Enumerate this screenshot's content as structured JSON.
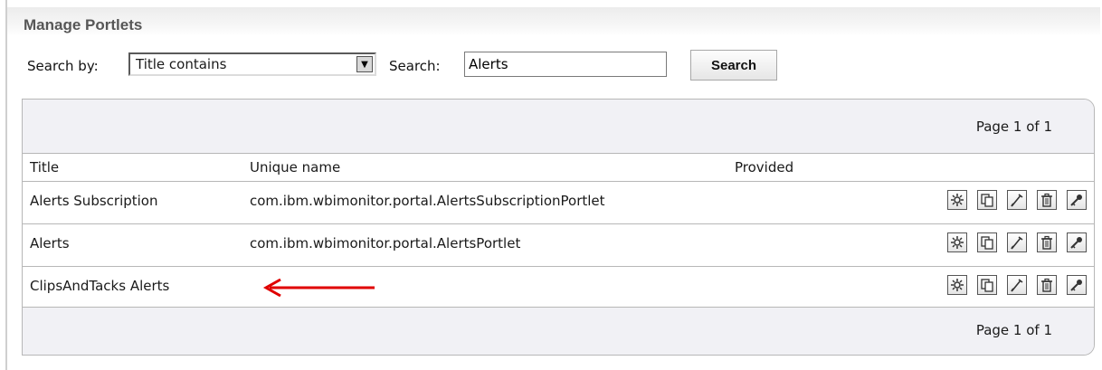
{
  "portlet": {
    "title": "Manage Portlets"
  },
  "search": {
    "search_by_label": "Search by:",
    "search_by_value": "Title contains",
    "search_label": "Search:",
    "search_value": "Alerts",
    "search_button": "Search"
  },
  "table": {
    "pager_top": "Page 1 of 1",
    "pager_bottom": "Page 1 of 1",
    "columns": [
      "Title",
      "Unique name",
      "Provided"
    ],
    "rows": [
      {
        "title": "Alerts Subscription",
        "unique_name": "com.ibm.wbimonitor.portal.AlertsSubscriptionPortlet",
        "provided": ""
      },
      {
        "title": "Alerts",
        "unique_name": "com.ibm.wbimonitor.portal.AlertsPortlet",
        "provided": ""
      },
      {
        "title": "ClipsAndTacks Alerts",
        "unique_name": "",
        "provided": ""
      }
    ],
    "row_actions": [
      "configure-icon",
      "copy-icon",
      "edit-icon",
      "delete-icon",
      "access-key-icon"
    ]
  },
  "colors": {
    "annotation_arrow": "#e00000",
    "title_text": "#575757",
    "pager_bg": "#f1f1f5",
    "border": "#b7b7b7"
  }
}
